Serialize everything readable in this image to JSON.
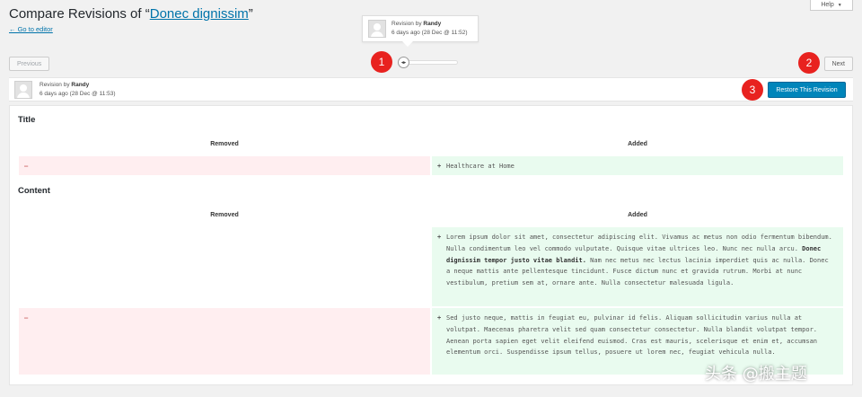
{
  "header": {
    "title_prefix": "Compare Revisions of “",
    "title_link": "Donec dignissim",
    "title_suffix": "”",
    "go_to_editor": "← Go to editor",
    "help": "Help",
    "help_chevron": "▼"
  },
  "tooltip": {
    "prefix": "Revision by ",
    "author": "Randy",
    "time": "6 days ago (28 Dec @ 11:52)"
  },
  "nav": {
    "previous": "Previous",
    "next": "Next",
    "slider_handle": "◂▸"
  },
  "markers": [
    "1",
    "2",
    "3"
  ],
  "revision": {
    "prefix": "Revision by ",
    "author": "Randy",
    "time": "6 days ago (28 Dec @ 11:53)",
    "restore": "Restore This Revision"
  },
  "diff": {
    "title_section": {
      "heading": "Title",
      "removed_label": "Removed",
      "added_label": "Added",
      "removed_sign": "–",
      "added_sign": "+",
      "added_text": "Healthcare at Home"
    },
    "content_section": {
      "heading": "Content",
      "removed_label": "Removed",
      "added_label": "Added",
      "added_sign": "+",
      "removed_sign": "–",
      "para1_a": "Lorem ipsum dolor sit amet, consectetur adipiscing elit. Vivamus ac metus non odio fermentum bibendum. Nulla condimentum leo vel commodo vulputate. Quisque vitae ultrices leo. Nunc nec nulla arcu. ",
      "para1_bold": "Donec dignissim tempor justo vitae blandit.",
      "para1_b": " Nam nec metus nec lectus lacinia imperdiet quis ac nulla. Donec a neque mattis ante pellentesque tincidunt. Fusce dictum nunc et gravida rutrum. Morbi at nunc vestibulum, pretium sem at, ornare ante. Nulla consectetur malesuada ligula.",
      "para2": "Sed justo neque, mattis in feugiat eu, pulvinar id felis. Aliquam sollicitudin varius nulla at volutpat. Maecenas pharetra velit sed quam consectetur consectetur. Nulla blandit volutpat tempor. Aenean porta sapien eget velit eleifend euismod. Cras est mauris, scelerisque et enim et, accumsan elementum orci. Suspendisse ipsum tellus, posuere ut lorem nec, feugiat vehicula nulla."
    }
  },
  "watermark": "头条 @搬主题"
}
